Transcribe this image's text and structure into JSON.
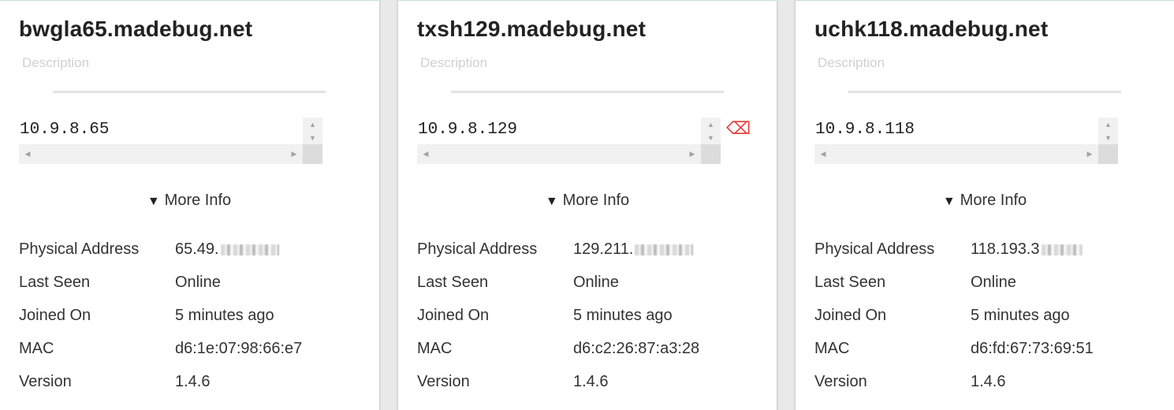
{
  "colors": {
    "card_bg": "#ffffff",
    "page_bg": "#e9e9e9",
    "clear_icon": "#e53935",
    "placeholder": "#d0d0d0"
  },
  "cards": [
    {
      "title": "bwgla65.madebug.net",
      "description_placeholder": "Description",
      "ip": "10.9.8.65",
      "more_info_label": "More Info",
      "rows": {
        "physical_address": {
          "label": "Physical Address",
          "value": "65.49."
        },
        "last_seen": {
          "label": "Last Seen",
          "value": "Online"
        },
        "joined_on": {
          "label": "Joined On",
          "value": "5 minutes ago"
        },
        "mac": {
          "label": "MAC",
          "value": "d6:1e:07:98:66:e7"
        },
        "version": {
          "label": "Version",
          "value": "1.4.6"
        }
      }
    },
    {
      "title": "txsh129.madebug.net",
      "description_placeholder": "Description",
      "ip": "10.9.8.129",
      "more_info_label": "More Info",
      "rows": {
        "physical_address": {
          "label": "Physical Address",
          "value": "129.211."
        },
        "last_seen": {
          "label": "Last Seen",
          "value": "Online"
        },
        "joined_on": {
          "label": "Joined On",
          "value": "5 minutes ago"
        },
        "mac": {
          "label": "MAC",
          "value": "d6:c2:26:87:a3:28"
        },
        "version": {
          "label": "Version",
          "value": "1.4.6"
        }
      }
    },
    {
      "title": "uchk118.madebug.net",
      "description_placeholder": "Description",
      "ip": "10.9.8.118",
      "more_info_label": "More Info",
      "rows": {
        "physical_address": {
          "label": "Physical Address",
          "value": "118.193.3"
        },
        "last_seen": {
          "label": "Last Seen",
          "value": "Online"
        },
        "joined_on": {
          "label": "Joined On",
          "value": "5 minutes ago"
        },
        "mac": {
          "label": "MAC",
          "value": "d6:fd:67:73:69:51"
        },
        "version": {
          "label": "Version",
          "value": "1.4.6"
        }
      }
    }
  ],
  "icons": {
    "clear": "backspace-icon",
    "expand": "triangle-down-icon"
  }
}
